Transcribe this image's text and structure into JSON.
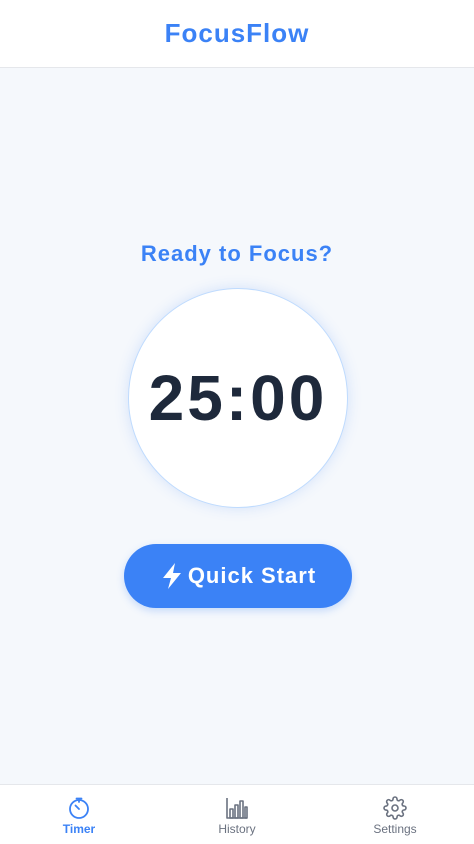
{
  "header": {
    "title": "FocusFlow"
  },
  "main": {
    "prompt": "Ready to Focus?",
    "timer": "25:00",
    "quick_start": {
      "label": "Quick Start",
      "icon": "lightning-bolt-icon"
    }
  },
  "nav": {
    "items": [
      {
        "label": "Timer",
        "icon": "timer-icon",
        "active": true
      },
      {
        "label": "History",
        "icon": "bar-chart-icon",
        "active": false
      },
      {
        "label": "Settings",
        "icon": "gear-icon",
        "active": false
      }
    ]
  },
  "colors": {
    "accent": "#3b82f6",
    "timer_text": "#1e293b",
    "background": "#f5f8fc",
    "inactive_nav": "#6b7280"
  }
}
